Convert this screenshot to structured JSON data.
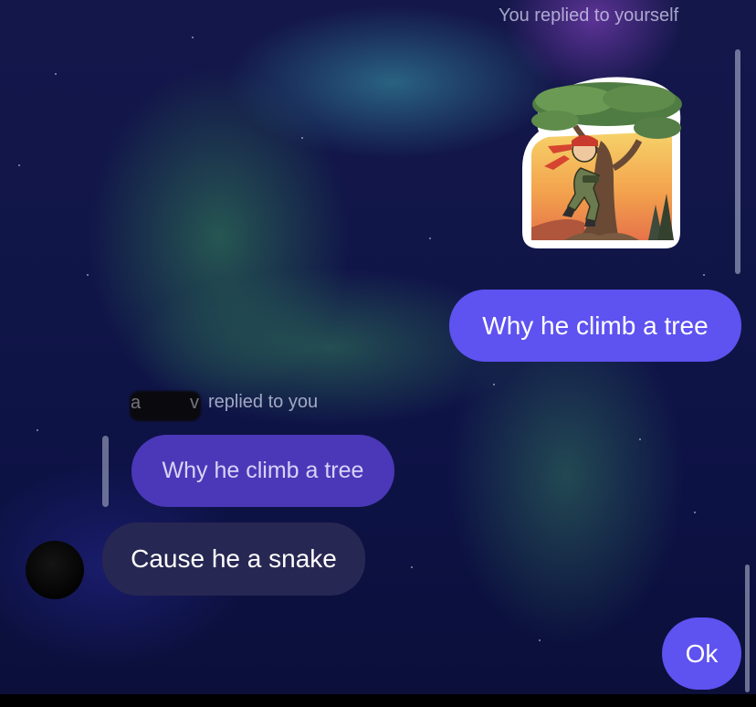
{
  "conversation": {
    "self_reply_label": "You replied to yourself",
    "sticker": {
      "icon": "sticker-soldier-climbing-tree"
    },
    "sent_message_1": "Why he climb a tree",
    "other_reply": {
      "name_visible_prefix": "a",
      "name_visible_suffix": "v",
      "label": "replied to you",
      "quoted_text": "Why he climb a tree"
    },
    "received_message": "Cause he a snake",
    "sent_message_2": "Ok"
  },
  "theme": {
    "sent_bubble_color": "#5e52f0",
    "received_bubble_color": "#272753",
    "quoted_bubble_color": "#4a38b8",
    "background_style": "aurora"
  }
}
